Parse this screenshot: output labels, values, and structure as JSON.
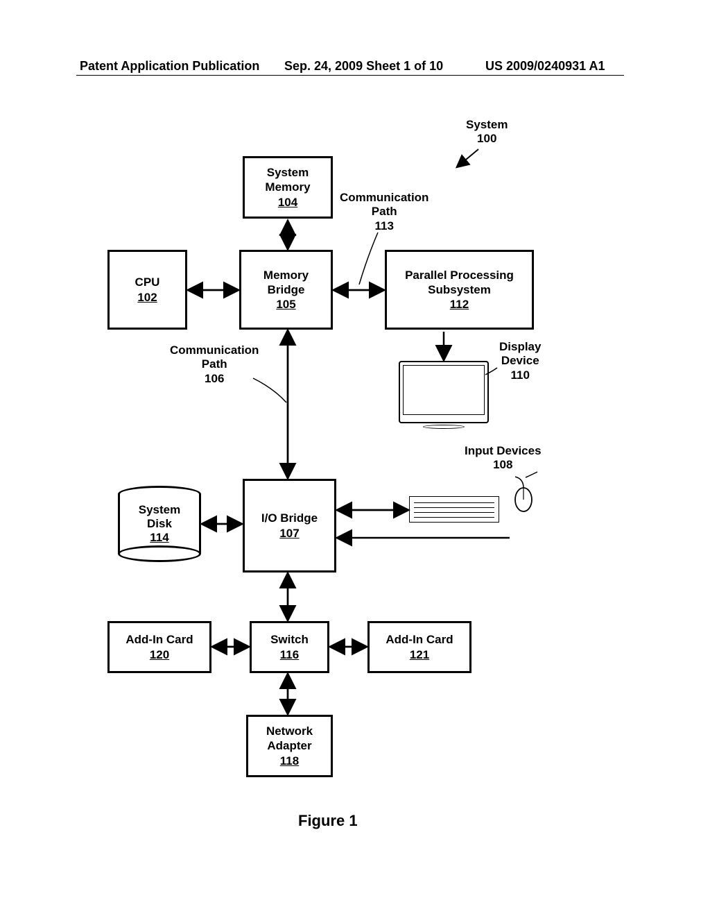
{
  "header": {
    "left": "Patent Application Publication",
    "mid": "Sep. 24, 2009  Sheet 1 of 10",
    "right": "US 2009/0240931 A1"
  },
  "labels": {
    "system": "System",
    "system_num": "100",
    "comm_path_113_t": "Communication",
    "comm_path_113_m": "Path",
    "comm_path_113_n": "113",
    "comm_path_106_t": "Communication",
    "comm_path_106_m": "Path",
    "comm_path_106_n": "106",
    "display_t": "Display",
    "display_m": "Device",
    "display_n": "110",
    "input_t": "Input Devices",
    "input_n": "108"
  },
  "boxes": {
    "sysmem_t": "System",
    "sysmem_m": "Memory",
    "sysmem_n": "104",
    "cpu_t": "CPU",
    "cpu_n": "102",
    "membr_t": "Memory",
    "membr_m": "Bridge",
    "membr_n": "105",
    "pps_t": "Parallel Processing",
    "pps_m": "Subsystem",
    "pps_n": "112",
    "sysdisk_t": "System",
    "sysdisk_m": "Disk",
    "sysdisk_n": "114",
    "iobr_t": "I/O Bridge",
    "iobr_n": "107",
    "add120_t": "Add-In Card",
    "add120_n": "120",
    "switch_t": "Switch",
    "switch_n": "116",
    "add121_t": "Add-In Card",
    "add121_n": "121",
    "net_t": "Network",
    "net_m": "Adapter",
    "net_n": "118"
  },
  "figure_caption": "Figure 1",
  "chart_data": {
    "type": "diagram",
    "title": "Figure 1 — Computer System 100 Block Diagram",
    "nodes": [
      {
        "id": "100",
        "name": "System"
      },
      {
        "id": "102",
        "name": "CPU"
      },
      {
        "id": "104",
        "name": "System Memory"
      },
      {
        "id": "105",
        "name": "Memory Bridge"
      },
      {
        "id": "106",
        "name": "Communication Path"
      },
      {
        "id": "107",
        "name": "I/O Bridge"
      },
      {
        "id": "108",
        "name": "Input Devices"
      },
      {
        "id": "110",
        "name": "Display Device"
      },
      {
        "id": "112",
        "name": "Parallel Processing Subsystem"
      },
      {
        "id": "113",
        "name": "Communication Path"
      },
      {
        "id": "114",
        "name": "System Disk"
      },
      {
        "id": "116",
        "name": "Switch"
      },
      {
        "id": "118",
        "name": "Network Adapter"
      },
      {
        "id": "120",
        "name": "Add-In Card"
      },
      {
        "id": "121",
        "name": "Add-In Card"
      }
    ],
    "edges": [
      {
        "from": "104",
        "to": "105",
        "bidir": true
      },
      {
        "from": "102",
        "to": "105",
        "bidir": true
      },
      {
        "from": "105",
        "to": "112",
        "bidir": true,
        "via": "113"
      },
      {
        "from": "105",
        "to": "107",
        "bidir": true,
        "via": "106"
      },
      {
        "from": "112",
        "to": "110",
        "bidir": false
      },
      {
        "from": "114",
        "to": "107",
        "bidir": true
      },
      {
        "from": "107",
        "to": "108",
        "bidir": true
      },
      {
        "from": "107",
        "to": "116",
        "bidir": true
      },
      {
        "from": "116",
        "to": "120",
        "bidir": true
      },
      {
        "from": "116",
        "to": "121",
        "bidir": true
      },
      {
        "from": "116",
        "to": "118",
        "bidir": true
      }
    ]
  }
}
